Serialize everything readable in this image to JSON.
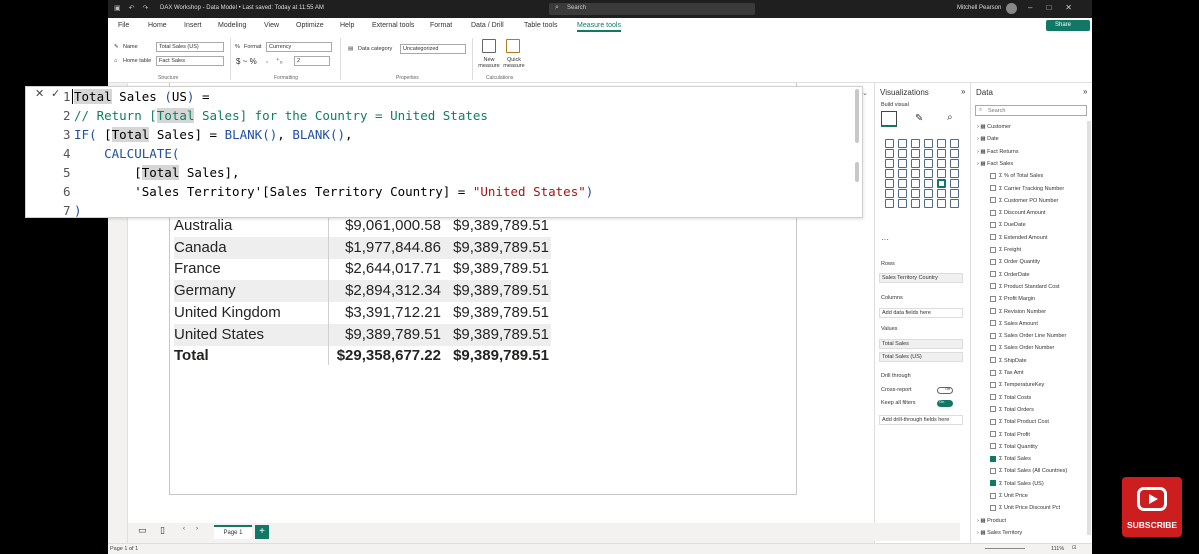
{
  "window": {
    "title": "DAX Workshop - Data Model • Last saved: Today at 11:55 AM",
    "search_placeholder": "Search",
    "user": "Mitchell Pearson"
  },
  "menu": [
    "File",
    "Home",
    "Insert",
    "Modeling",
    "View",
    "Optimize",
    "Help",
    "External tools",
    "Format",
    "Data / Drill",
    "Table tools",
    "Measure tools"
  ],
  "share_label": "Share",
  "ribbon": {
    "name_label": "Name",
    "name_value": "Total Sales (US)",
    "home_table_label": "Home table",
    "home_table_value": "Fact Sales",
    "structure_label": "Structure",
    "format_label": "Format",
    "format_value": "Currency",
    "format_symbols": "$ ~ %",
    "decimals_value": "2",
    "formatting_label": "Formatting",
    "data_category_label": "Data category",
    "data_category_value": "Uncategorized",
    "properties_label": "Properties",
    "new_measure_label": "New measure",
    "quick_measure_label": "Quick measure",
    "calculations_label": "Calculations"
  },
  "formula": {
    "lines": [
      {
        "n": "1",
        "text": "Total Sales (US) ="
      },
      {
        "n": "2",
        "text": "// Return [Total Sales] for the Country = United States"
      },
      {
        "n": "3",
        "text": "IF( [Total Sales] = BLANK(), BLANK(),"
      },
      {
        "n": "4",
        "text": "    CALCULATE("
      },
      {
        "n": "5",
        "text": "        [Total Sales],"
      },
      {
        "n": "6",
        "text": "        'Sales Territory'[Sales Territory Country] = \"United States\")"
      },
      {
        "n": "7",
        "text": ")"
      }
    ]
  },
  "table": {
    "rows": [
      {
        "country": "Australia",
        "total_sales": "$9,061,000.58",
        "total_sales_us": "$9,389,789.51"
      },
      {
        "country": "Canada",
        "total_sales": "$1,977,844.86",
        "total_sales_us": "$9,389,789.51"
      },
      {
        "country": "France",
        "total_sales": "$2,644,017.71",
        "total_sales_us": "$9,389,789.51"
      },
      {
        "country": "Germany",
        "total_sales": "$2,894,312.34",
        "total_sales_us": "$9,389,789.51"
      },
      {
        "country": "United Kingdom",
        "total_sales": "$3,391,712.21",
        "total_sales_us": "$9,389,789.51"
      },
      {
        "country": "United States",
        "total_sales": "$9,389,789.51",
        "total_sales_us": "$9,389,789.51"
      }
    ],
    "total": {
      "label": "Total",
      "total_sales": "$29,358,677.22",
      "total_sales_us": "$9,389,789.51"
    }
  },
  "pages": {
    "page1": "Page 1",
    "add": "+"
  },
  "status": {
    "page": "Page 1 of 1",
    "zoom": "111%"
  },
  "viz": {
    "title": "Visualizations",
    "build_visual": "Build visual",
    "rows_label": "Rows",
    "rows_value": "Sales Territory Country",
    "columns_label": "Columns",
    "columns_placeholder": "Add data fields here",
    "values_label": "Values",
    "values": [
      "Total Sales",
      "Total Sales (US)"
    ],
    "drill_label": "Drill through",
    "cross_report_label": "Cross-report",
    "cross_report_state": "Off",
    "keep_filters_label": "Keep all filters",
    "keep_filters_state": "On",
    "drill_placeholder": "Add drill-through fields here"
  },
  "data_pane": {
    "title": "Data",
    "search_placeholder": "Search",
    "tables_top": [
      "Customer",
      "Date",
      "Fact Returns",
      "Fact Sales"
    ],
    "fields": [
      {
        "name": "% of Total Sales",
        "checked": false
      },
      {
        "name": "Carrier Tracking Number",
        "checked": false
      },
      {
        "name": "Customer PO Number",
        "checked": false
      },
      {
        "name": "Discount Amount",
        "checked": false
      },
      {
        "name": "DueDate",
        "checked": false
      },
      {
        "name": "Extended Amount",
        "checked": false
      },
      {
        "name": "Freight",
        "checked": false
      },
      {
        "name": "Order Quantity",
        "checked": false
      },
      {
        "name": "OrderDate",
        "checked": false
      },
      {
        "name": "Product Standard Cost",
        "checked": false
      },
      {
        "name": "Profit Margin",
        "checked": false
      },
      {
        "name": "Revision Number",
        "checked": false
      },
      {
        "name": "Sales Amount",
        "checked": false
      },
      {
        "name": "Sales Order Line Number",
        "checked": false
      },
      {
        "name": "Sales Order Number",
        "checked": false
      },
      {
        "name": "ShipDate",
        "checked": false
      },
      {
        "name": "Tax Amt",
        "checked": false
      },
      {
        "name": "TemperatureKey",
        "checked": false
      },
      {
        "name": "Total Costs",
        "checked": false
      },
      {
        "name": "Total Orders",
        "checked": false
      },
      {
        "name": "Total Product Cost",
        "checked": false
      },
      {
        "name": "Total Profit",
        "checked": false
      },
      {
        "name": "Total Quantity",
        "checked": false
      },
      {
        "name": "Total Sales",
        "checked": true
      },
      {
        "name": "Total Sales (All Countries)",
        "checked": false
      },
      {
        "name": "Total Sales (US)",
        "checked": true
      },
      {
        "name": "Unit Price",
        "checked": false
      },
      {
        "name": "Unit Price Discount Pct",
        "checked": false
      }
    ],
    "tables_bottom": [
      "Product",
      "Sales Territory"
    ]
  },
  "subscribe_label": "SUBSCRIBE",
  "colors": {
    "accent": "#117865",
    "subscribe": "#cc1e1e"
  }
}
